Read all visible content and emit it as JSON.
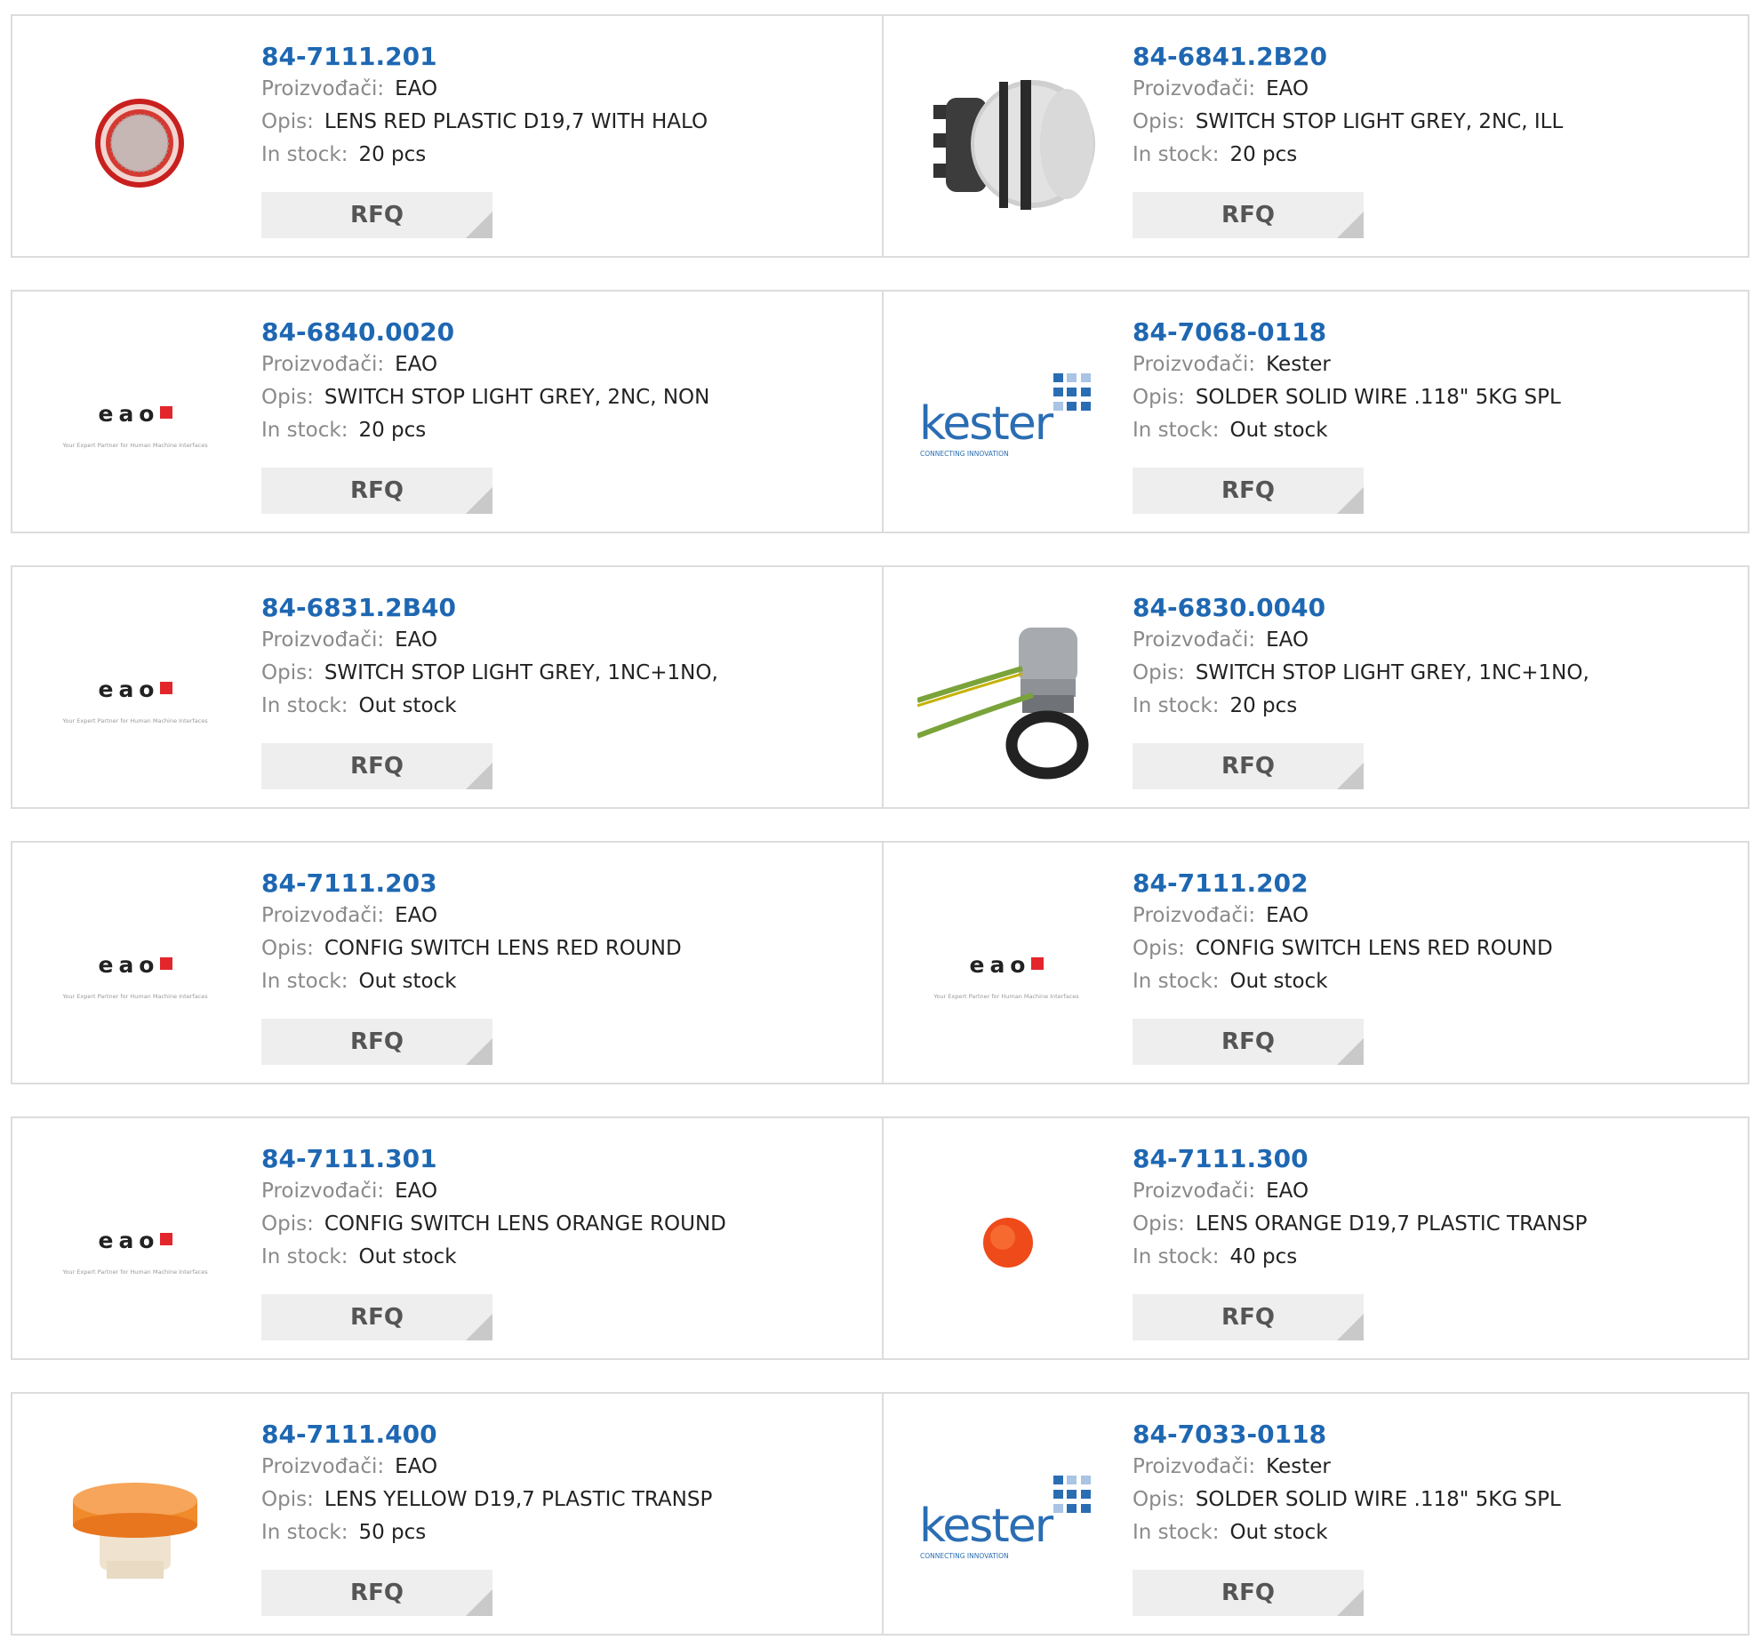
{
  "labels": {
    "manufacturer": "Proizvođači:",
    "description": "Opis:",
    "stock": "In stock:",
    "rfq": "RFQ"
  },
  "products": [
    {
      "pn": "84-7111.201",
      "mfr": "EAO",
      "desc": "LENS RED PLASTIC D19,7 WITH HALO",
      "stock": "20 pcs",
      "image": "red-halo-lens-image"
    },
    {
      "pn": "84-6841.2B20",
      "mfr": "EAO",
      "desc": "SWITCH STOP LIGHT GREY, 2NC, ILL",
      "stock": "20 pcs",
      "image": "grey-stop-switch-image"
    },
    {
      "pn": "84-6840.0020",
      "mfr": "EAO",
      "desc": "SWITCH STOP LIGHT GREY, 2NC, NON",
      "stock": "20 pcs",
      "image": "eao-logo"
    },
    {
      "pn": "84-7068-0118",
      "mfr": "Kester",
      "desc": "SOLDER SOLID WIRE .118\" 5KG SPL",
      "stock": "Out stock",
      "image": "kester-logo"
    },
    {
      "pn": "84-6831.2B40",
      "mfr": "EAO",
      "desc": "SWITCH STOP LIGHT GREY, 1NC+1NO,",
      "stock": "Out stock",
      "image": "eao-logo"
    },
    {
      "pn": "84-6830.0040",
      "mfr": "EAO",
      "desc": "SWITCH STOP LIGHT GREY, 1NC+1NO,",
      "stock": "20 pcs",
      "image": "grey-switch-with-wires-image"
    },
    {
      "pn": "84-7111.203",
      "mfr": "EAO",
      "desc": "CONFIG SWITCH LENS RED ROUND",
      "stock": "Out stock",
      "image": "eao-logo"
    },
    {
      "pn": "84-7111.202",
      "mfr": "EAO",
      "desc": "CONFIG SWITCH LENS RED ROUND",
      "stock": "Out stock",
      "image": "eao-logo"
    },
    {
      "pn": "84-7111.301",
      "mfr": "EAO",
      "desc": "CONFIG SWITCH LENS ORANGE ROUND",
      "stock": "Out stock",
      "image": "eao-logo"
    },
    {
      "pn": "84-7111.300",
      "mfr": "EAO",
      "desc": "LENS ORANGE D19,7 PLASTIC TRANSP",
      "stock": "40 pcs",
      "image": "orange-lens-image"
    },
    {
      "pn": "84-7111.400",
      "mfr": "EAO",
      "desc": "LENS YELLOW D19,7 PLASTIC TRANSP",
      "stock": "50 pcs",
      "image": "yellow-lens-image"
    },
    {
      "pn": "84-7033-0118",
      "mfr": "Kester",
      "desc": "SOLDER SOLID WIRE .118\" 5KG SPL",
      "stock": "Out stock",
      "image": "kester-logo"
    }
  ],
  "logos": {
    "eao": {
      "wordmark": "eao",
      "tagline": "Your Expert Partner for Human Machine Interfaces"
    },
    "kester": {
      "wordmark": "kester",
      "tagline": "CONNECTING INNOVATION"
    }
  },
  "colors": {
    "link": "#1e67b2",
    "label": "#8a8a8a",
    "button_bg": "#eeeeee",
    "border": "#dcdcdc",
    "eao_red": "#e3262c",
    "kester_blue": "#2a6db3"
  }
}
